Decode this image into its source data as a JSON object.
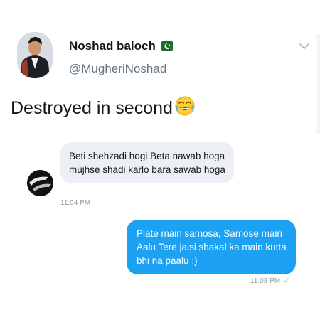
{
  "tweet": {
    "display_name": "Noshad baloch",
    "handle": "@MugheriNoshad",
    "text": "Destroyed in second",
    "emoji": "😂",
    "flag_icon": "pakistan-flag-icon",
    "menu_icon": "chevron-down-icon"
  },
  "conversation": {
    "incoming": {
      "text": "Beti shehzadi hogi Beta nawab hoga mujhse shadi karlo bara sawab hoga",
      "time": "11:04 PM"
    },
    "outgoing": {
      "text": "Plate main samosa, Samose main Aalu Tere jaisi shakal ka main kutta bhi na paalu :)",
      "time": "11:08 PM",
      "status_icon": "check-icon"
    }
  },
  "colors": {
    "accent": "#1da1f2",
    "bubble_in": "#eceff3",
    "secondary_text": "#657786"
  }
}
